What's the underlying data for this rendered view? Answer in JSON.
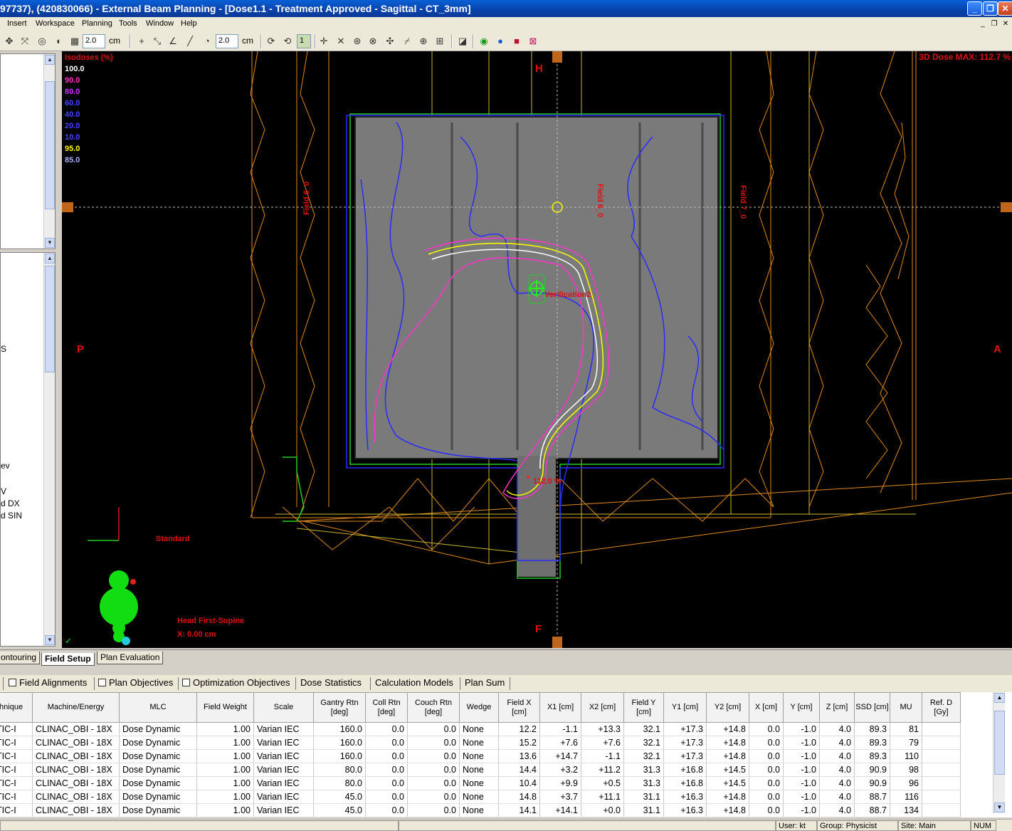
{
  "window": {
    "title": "97737), (420830066) - External Beam Planning - [Dose1.1  -  Treatment Approved - Sagittal - CT_3mm]",
    "buttons": {
      "minimize": "_",
      "restore": "❐",
      "close": "✕"
    }
  },
  "menu": {
    "items": [
      "Insert",
      "Workspace",
      "Planning",
      "Tools",
      "Window",
      "Help"
    ]
  },
  "toolbar": {
    "grid_value": "2.0",
    "grid_unit": "cm",
    "ruler_value": "2.0",
    "ruler_unit": "cm",
    "layer_value": "1"
  },
  "left_panel": {
    "fragments": [
      "S",
      "P",
      "ev",
      "V",
      "d DX",
      "d SIN"
    ]
  },
  "viewer": {
    "isodose_title": "Isodoses (%)",
    "isodoses": [
      {
        "label": "100.0",
        "color": "#ffffff"
      },
      {
        "label": "90.0",
        "color": "#ff33cc"
      },
      {
        "label": "80.0",
        "color": "#cc33ff"
      },
      {
        "label": "60.0",
        "color": "#4444ff"
      },
      {
        "label": "40.0",
        "color": "#4444ff"
      },
      {
        "label": "20.0",
        "color": "#4444ff"
      },
      {
        "label": "10.0",
        "color": "#4444ff"
      },
      {
        "label": "95.0",
        "color": "#ffff00"
      },
      {
        "label": "85.0",
        "color": "#aaaaff"
      }
    ],
    "dose_max": "3D Dose MAX: 112.7 %",
    "orient_top": "H",
    "orient_bottom": "F",
    "orient_left": "P",
    "orient_right": "A",
    "field_labels": [
      "Field 6_0",
      "Field 6_0",
      "Field 7_0"
    ],
    "verification_label": "Verification2",
    "hotspot_label": "112.0 %",
    "standard_label": "Standard",
    "patient_orientation": "Head First-Supine",
    "x_coord": "X: 0.00 cm"
  },
  "workspace_tabs": [
    "ontouring",
    "Field Setup",
    "Plan Evaluation"
  ],
  "panel_tabs": [
    {
      "label": "Field Alignments",
      "checkbox": true
    },
    {
      "label": "Plan Objectives",
      "checkbox": true
    },
    {
      "label": "Optimization Objectives",
      "checkbox": true
    },
    {
      "label": "Dose Statistics",
      "checkbox": false
    },
    {
      "label": "Calculation Models",
      "checkbox": false
    },
    {
      "label": "Plan Sum",
      "checkbox": false
    }
  ],
  "table": {
    "headers": [
      "Technique",
      "Machine/Energy",
      "MLC",
      "Field Weight",
      "Scale",
      "Gantry Rtn [deg]",
      "Coll Rtn [deg]",
      "Couch Rtn [deg]",
      "Wedge",
      "Field X [cm]",
      "X1 [cm]",
      "X2 [cm]",
      "Field Y [cm]",
      "Y1 [cm]",
      "Y2 [cm]",
      "X [cm]",
      "Y [cm]",
      "Z [cm]",
      "SSD [cm]",
      "MU",
      "Ref. D [Gy]"
    ],
    "rows": [
      [
        "STATIC-I",
        "CLINAC_OBI - 18X",
        "Dose Dynamic",
        "1.00",
        "Varian IEC",
        "160.0",
        "0.0",
        "0.0",
        "None",
        "12.2",
        "-1.1",
        "+13.3",
        "32.1",
        "+17.3",
        "+14.8",
        "0.0",
        "-1.0",
        "4.0",
        "89.3",
        "81",
        ""
      ],
      [
        "STATIC-I",
        "CLINAC_OBI - 18X",
        "Dose Dynamic",
        "1.00",
        "Varian IEC",
        "160.0",
        "0.0",
        "0.0",
        "None",
        "15.2",
        "+7.6",
        "+7.6",
        "32.1",
        "+17.3",
        "+14.8",
        "0.0",
        "-1.0",
        "4.0",
        "89.3",
        "79",
        ""
      ],
      [
        "STATIC-I",
        "CLINAC_OBI - 18X",
        "Dose Dynamic",
        "1.00",
        "Varian IEC",
        "160.0",
        "0.0",
        "0.0",
        "None",
        "13.6",
        "+14.7",
        "-1.1",
        "32.1",
        "+17.3",
        "+14.8",
        "0.0",
        "-1.0",
        "4.0",
        "89.3",
        "110",
        ""
      ],
      [
        "STATIC-I",
        "CLINAC_OBI - 18X",
        "Dose Dynamic",
        "1.00",
        "Varian IEC",
        "80.0",
        "0.0",
        "0.0",
        "None",
        "14.4",
        "+3.2",
        "+11.2",
        "31.3",
        "+16.8",
        "+14.5",
        "0.0",
        "-1.0",
        "4.0",
        "90.9",
        "98",
        ""
      ],
      [
        "STATIC-I",
        "CLINAC_OBI - 18X",
        "Dose Dynamic",
        "1.00",
        "Varian IEC",
        "80.0",
        "0.0",
        "0.0",
        "None",
        "10.4",
        "+9.9",
        "+0.5",
        "31.3",
        "+16.8",
        "+14.5",
        "0.0",
        "-1.0",
        "4.0",
        "90.9",
        "96",
        ""
      ],
      [
        "STATIC-I",
        "CLINAC_OBI - 18X",
        "Dose Dynamic",
        "1.00",
        "Varian IEC",
        "45.0",
        "0.0",
        "0.0",
        "None",
        "14.8",
        "+3.7",
        "+11.1",
        "31.1",
        "+16.3",
        "+14.8",
        "0.0",
        "-1.0",
        "4.0",
        "88.7",
        "116",
        ""
      ],
      [
        "STATIC-I",
        "CLINAC_OBI - 18X",
        "Dose Dynamic",
        "1.00",
        "Varian IEC",
        "45.0",
        "0.0",
        "0.0",
        "None",
        "14.1",
        "+14.1",
        "+0.0",
        "31.1",
        "+16.3",
        "+14.8",
        "0.0",
        "-1.0",
        "4.0",
        "88.7",
        "134",
        ""
      ]
    ]
  },
  "status": {
    "user": "User: kt",
    "group": "Group: Physicist",
    "site": "Site: Main",
    "num": "NUM"
  }
}
